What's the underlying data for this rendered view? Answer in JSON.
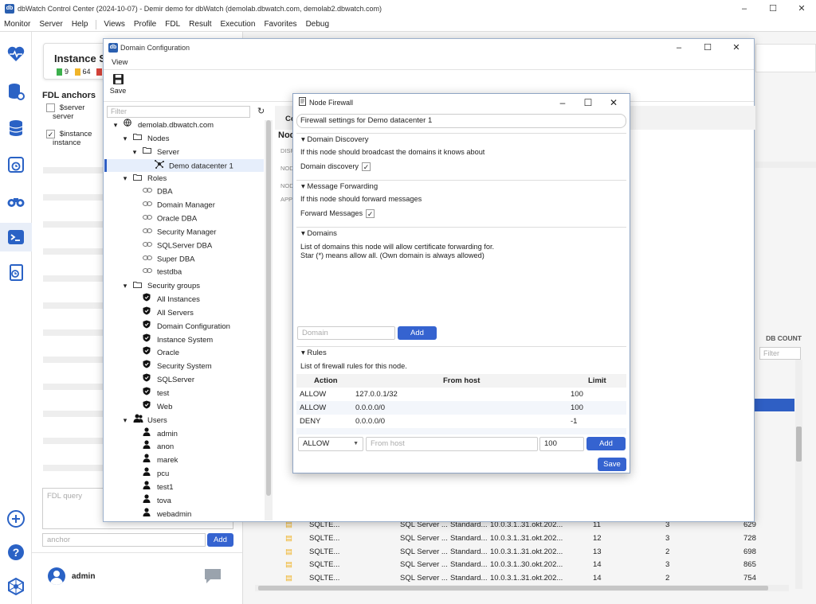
{
  "app": {
    "title": "dbWatch Control Center  (2024-10-07) - Demir demo for dbWatch (demolab.dbwatch.com, demolab2.dbwatch.com)",
    "icon_label": "db",
    "window_buttons": [
      "–",
      "☐",
      "✕"
    ]
  },
  "menu": {
    "left": [
      "Monitor",
      "Server",
      "Help"
    ],
    "right": [
      "Views",
      "Profile",
      "FDL",
      "Result",
      "Execution",
      "Favorites",
      "Debug"
    ]
  },
  "sidebar": {
    "icons": [
      "heartbeat-icon",
      "database-settings-icon",
      "database-stack-icon",
      "database-clock-icon",
      "binoculars-icon",
      "terminal-icon",
      "docs-icon",
      "add-icon",
      "help-icon",
      "network-icon"
    ]
  },
  "instance_card": {
    "title": "Instance S",
    "count1": "9",
    "count2": "64"
  },
  "fdl": {
    "heading": "FDL anchors",
    "anchors": [
      {
        "line1": "$server",
        "line2": "server",
        "checked": false
      },
      {
        "line1": "$instance",
        "line2": "instance",
        "checked": true
      }
    ],
    "query_placeholder": "FDL query",
    "anchor_placeholder": "anchor",
    "add_label": "Add",
    "user": "admin"
  },
  "domain_config": {
    "title": "Domain Configuration",
    "icon_label": "db",
    "menu_view": "View",
    "save_label": "Save",
    "filter_placeholder": "Filter",
    "tree": [
      {
        "label": "demolab.dbwatch.com",
        "level": 0,
        "icon": "globe",
        "toggle": "▾"
      },
      {
        "label": "Nodes",
        "level": 1,
        "icon": "folder",
        "toggle": "▾"
      },
      {
        "label": "Server",
        "level": 2,
        "icon": "folder",
        "toggle": "▾"
      },
      {
        "label": "Demo datacenter 1",
        "level": 3,
        "icon": "node",
        "toggle": "",
        "selected": true
      },
      {
        "label": "Roles",
        "level": 1,
        "icon": "folder",
        "toggle": "▾"
      },
      {
        "label": "DBA",
        "level": 2,
        "icon": "role",
        "toggle": ""
      },
      {
        "label": "Domain Manager",
        "level": 2,
        "icon": "role",
        "toggle": ""
      },
      {
        "label": "Oracle DBA",
        "level": 2,
        "icon": "role",
        "toggle": ""
      },
      {
        "label": "Security Manager",
        "level": 2,
        "icon": "role",
        "toggle": ""
      },
      {
        "label": "SQLServer DBA",
        "level": 2,
        "icon": "role",
        "toggle": ""
      },
      {
        "label": "Super DBA",
        "level": 2,
        "icon": "role",
        "toggle": ""
      },
      {
        "label": "testdba",
        "level": 2,
        "icon": "role",
        "toggle": ""
      },
      {
        "label": "Security groups",
        "level": 1,
        "icon": "folder",
        "toggle": "▾"
      },
      {
        "label": "All Instances",
        "level": 2,
        "icon": "shield",
        "toggle": ""
      },
      {
        "label": "All Servers",
        "level": 2,
        "icon": "shield",
        "toggle": ""
      },
      {
        "label": "Domain Configuration",
        "level": 2,
        "icon": "shield",
        "toggle": ""
      },
      {
        "label": "Instance System",
        "level": 2,
        "icon": "shield",
        "toggle": ""
      },
      {
        "label": "Oracle",
        "level": 2,
        "icon": "shield",
        "toggle": ""
      },
      {
        "label": "Security System",
        "level": 2,
        "icon": "shield",
        "toggle": ""
      },
      {
        "label": "SQLServer",
        "level": 2,
        "icon": "shield",
        "toggle": ""
      },
      {
        "label": "test",
        "level": 2,
        "icon": "shield",
        "toggle": ""
      },
      {
        "label": "Web",
        "level": 2,
        "icon": "shield",
        "toggle": ""
      },
      {
        "label": "Users",
        "level": 1,
        "icon": "users",
        "toggle": "▾"
      },
      {
        "label": "admin",
        "level": 2,
        "icon": "user",
        "toggle": ""
      },
      {
        "label": "anon",
        "level": 2,
        "icon": "user",
        "toggle": ""
      },
      {
        "label": "marek",
        "level": 2,
        "icon": "user",
        "toggle": ""
      },
      {
        "label": "pcu",
        "level": 2,
        "icon": "user",
        "toggle": ""
      },
      {
        "label": "test1",
        "level": 2,
        "icon": "user",
        "toggle": ""
      },
      {
        "label": "tova",
        "level": 2,
        "icon": "user",
        "toggle": ""
      },
      {
        "label": "webadmin",
        "level": 2,
        "icon": "user",
        "toggle": ""
      }
    ],
    "right_tab": "Co",
    "node_heading": "Nod",
    "field_labels": [
      "DISP",
      "NOD",
      "NOD",
      "APP"
    ]
  },
  "firewall": {
    "title": "Node Firewall",
    "settings_title": "Firewall settings for Demo datacenter 1",
    "discovery": {
      "header": "Domain Discovery",
      "desc": "If this node should broadcast the domains it knows about",
      "checkbox_label": "Domain discovery",
      "checked": true
    },
    "forwarding": {
      "header": "Message Forwarding",
      "desc": "If this node should forward messages",
      "checkbox_label": "Forward Messages",
      "checked": true
    },
    "domains": {
      "header": "Domains",
      "desc1": "List of domains this node will allow certificate forwarding for.",
      "desc2": "Star (*) means allow all. (Own domain is always allowed)",
      "input_placeholder": "Domain",
      "add_label": "Add"
    },
    "rules": {
      "header": "Rules",
      "desc": "List of firewall rules for this node.",
      "columns": [
        "Action",
        "From host",
        "Limit"
      ],
      "rows": [
        {
          "action": "ALLOW",
          "from": "127.0.0.1/32",
          "limit": "100"
        },
        {
          "action": "ALLOW",
          "from": "0.0.0.0/0",
          "limit": "100"
        },
        {
          "action": "DENY",
          "from": "0.0.0.0/0",
          "limit": "-1"
        }
      ],
      "action_select": "ALLOW",
      "from_placeholder": "From host",
      "limit_value": "100",
      "add_label": "Add"
    },
    "save_label": "Save"
  },
  "background_grid": {
    "db_count_header": "DB COUNT",
    "filter_placeholder": "Filter",
    "rows": [
      {
        "name": "SQLTE...",
        "type": "SQL Server ...",
        "edition": "Standard...",
        "version": "10.0.3.1...",
        "date": "31.okt.202...",
        "n1": "11",
        "n2": "3",
        "n3": "629"
      },
      {
        "name": "SQLTE...",
        "type": "SQL Server ...",
        "edition": "Standard...",
        "version": "10.0.3.1...",
        "date": "31.okt.202...",
        "n1": "12",
        "n2": "3",
        "n3": "728"
      },
      {
        "name": "SQLTE...",
        "type": "SQL Server ...",
        "edition": "Standard...",
        "version": "10.0.3.1...",
        "date": "31.okt.202...",
        "n1": "13",
        "n2": "2",
        "n3": "698"
      },
      {
        "name": "SQLTE...",
        "type": "SQL Server ...",
        "edition": "Standard...",
        "version": "10.0.3.1...",
        "date": "30.okt.202...",
        "n1": "14",
        "n2": "3",
        "n3": "865"
      },
      {
        "name": "SQLTE...",
        "type": "SQL Server ...",
        "edition": "Standard...",
        "version": "10.0.3.1...",
        "date": "31.okt.202...",
        "n1": "14",
        "n2": "2",
        "n3": "754"
      }
    ]
  },
  "colors": {
    "accent": "#3563d0",
    "selected_row": "#2f5fc4",
    "icon_blue": "#2a62c5"
  }
}
